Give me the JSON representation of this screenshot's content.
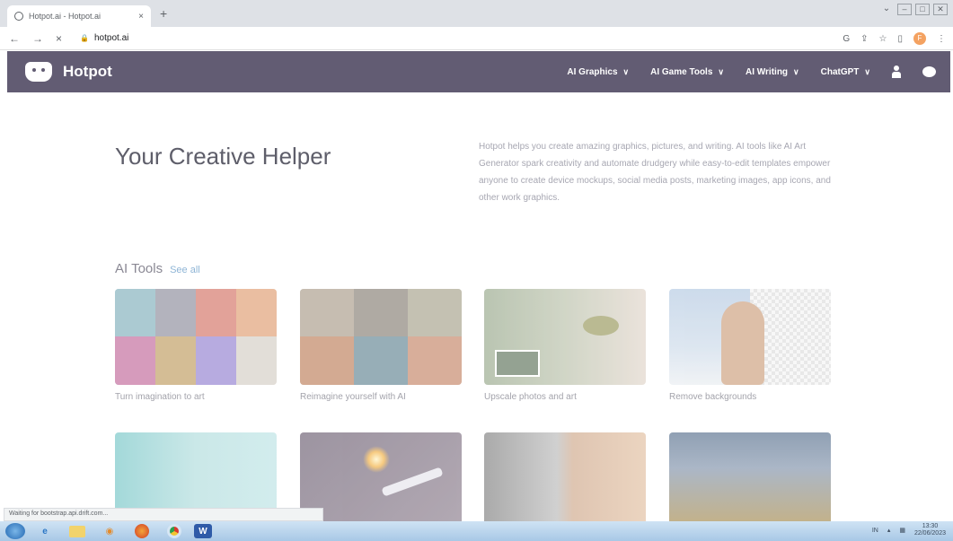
{
  "browser": {
    "tab_title": "Hotpot.ai - Hotpot.ai",
    "tab_close": "×",
    "new_tab": "+",
    "nav_back": "←",
    "nav_forward": "→",
    "nav_stop": "×",
    "url": "hotpot.ai",
    "status": "Waiting for bootstrap.api.drift.com..."
  },
  "site": {
    "logo_name": "Hotpot",
    "nav": [
      {
        "label": "AI Graphics"
      },
      {
        "label": "AI Game Tools"
      },
      {
        "label": "AI Writing"
      },
      {
        "label": "ChatGPT"
      }
    ],
    "chevron": "∨"
  },
  "hero": {
    "title": "Your Creative Helper",
    "description": "Hotpot helps you create amazing graphics, pictures, and writing. AI tools like AI Art Generator spark creativity and automate drudgery while easy-to-edit templates empower anyone to create device mockups, social media posts, marketing images, app icons, and other work graphics."
  },
  "tools": {
    "heading": "AI Tools",
    "see_all": "See all",
    "cards": [
      {
        "caption": "Turn imagination to art"
      },
      {
        "caption": "Reimagine yourself with AI"
      },
      {
        "caption": "Upscale photos and art"
      },
      {
        "caption": "Remove backgrounds"
      }
    ]
  },
  "taskbar": {
    "word_label": "W",
    "tray_lang": "IN",
    "time": "13:30",
    "date": "22/06/2023"
  },
  "colors": {
    "header_bg": "#625c73",
    "link": "#8fb5d6"
  }
}
